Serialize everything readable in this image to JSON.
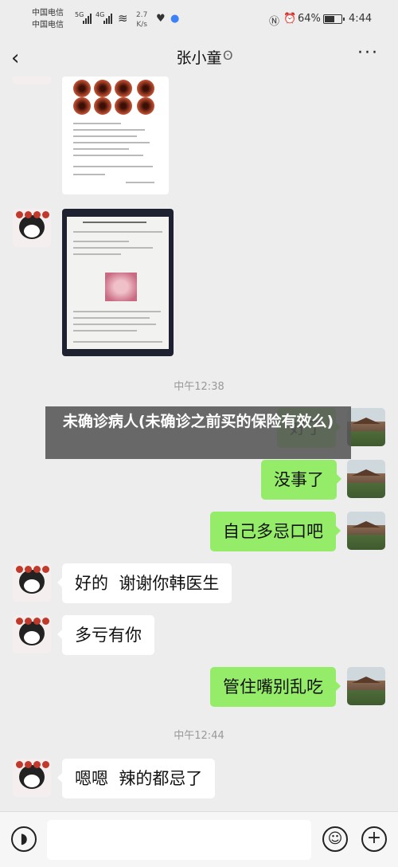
{
  "status_bar": {
    "carrier_1": "中国电信",
    "carrier_2": "中国电信",
    "net_1": "5G",
    "net_2": "4G",
    "speed_value": "2.7",
    "speed_unit": "K/s",
    "battery_percent": "64%",
    "time": "4:44"
  },
  "header": {
    "title": "张小童",
    "back_icon": "chevron-left-icon",
    "more_icon": "more-icon"
  },
  "messages": {
    "time_1": "中午12:38",
    "msg_1": "好了",
    "msg_2": "没事了",
    "msg_3": "自己多忌口吧",
    "msg_4": "好的  谢谢你韩医生",
    "msg_5": "多亏有你",
    "msg_6": "管住嘴别乱吃",
    "time_2": "中午12:44",
    "msg_7": "嗯嗯  辣的都忌了"
  },
  "banner": {
    "text": "未确诊病人(未确诊之前买的保险有效么)"
  },
  "input_bar": {
    "voice_icon": "voice-icon",
    "emoji_icon": "emoji-icon",
    "plus_icon": "plus-icon"
  }
}
